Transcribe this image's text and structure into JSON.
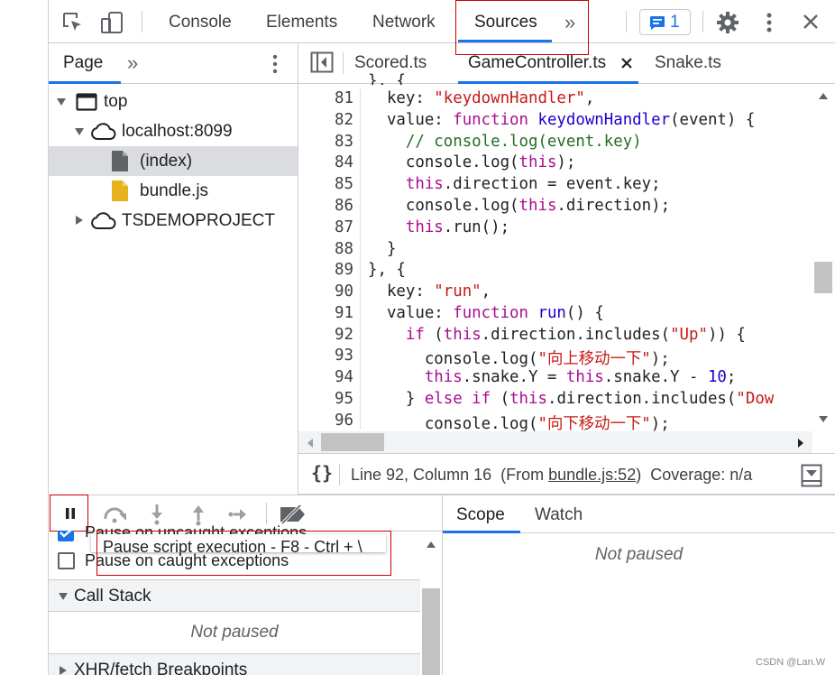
{
  "toolbar": {
    "tabs": [
      {
        "label": "Console"
      },
      {
        "label": "Elements"
      },
      {
        "label": "Network"
      },
      {
        "label": "Sources"
      }
    ],
    "issues_count": "1",
    "more_tabs": "»"
  },
  "navigator": {
    "tab_label": "Page",
    "more": "»",
    "tree": [
      {
        "label": "top"
      },
      {
        "label": "localhost:8099"
      },
      {
        "label": "(index)"
      },
      {
        "label": "bundle.js"
      },
      {
        "label": "TSDEMOPROJECT"
      }
    ]
  },
  "editor": {
    "tabs": [
      {
        "label": "Scored.ts"
      },
      {
        "label": "GameController.ts"
      },
      {
        "label": "Snake.ts"
      }
    ],
    "line_numbers": [
      "81",
      "82",
      "83",
      "84",
      "85",
      "86",
      "87",
      "88",
      "89",
      "90",
      "91",
      "92",
      "93",
      "94",
      "95",
      "96"
    ],
    "status": {
      "braces": "{}",
      "position": "Line 92, Column 16",
      "from_prefix": "(From ",
      "from_link": "bundle.js:52",
      "from_suffix": ")",
      "coverage": "Coverage: n/a"
    }
  },
  "debugger": {
    "tooltip": "Pause script execution - F8 - Ctrl + \\",
    "checkbox1_label": "Pause on uncaught exceptions",
    "checkbox2_label": "Pause on caught exceptions",
    "call_stack_label": "Call Stack",
    "call_stack_empty": "Not paused",
    "xhr_label": "XHR/fetch Breakpoints"
  },
  "scope_panel": {
    "tabs": [
      {
        "label": "Scope"
      },
      {
        "label": "Watch"
      }
    ],
    "empty": "Not paused"
  },
  "watermark": "CSDN @Lan.W",
  "colors": {
    "accent_blue": "#1a73e8",
    "highlight_red": "#cc0000",
    "selected_row": "#dadce0",
    "keyword": "#aa0d91",
    "string": "#c41a16",
    "comment": "#236e25"
  }
}
